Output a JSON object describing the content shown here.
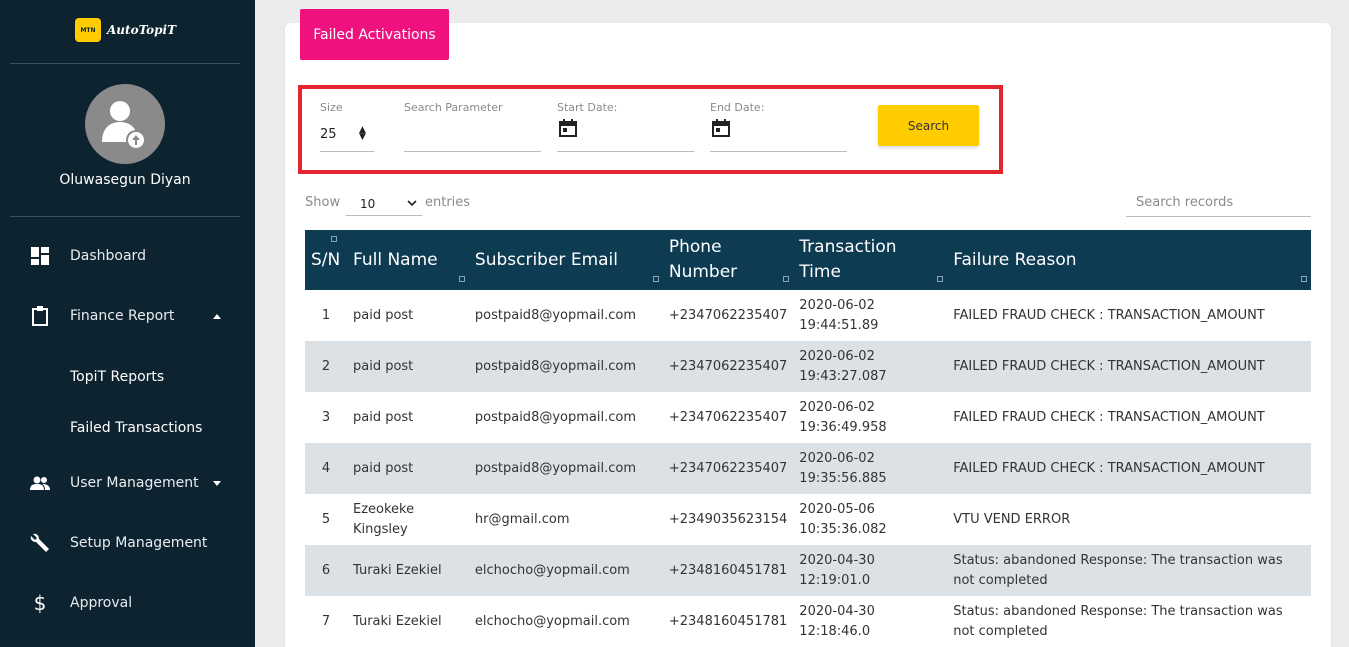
{
  "brand": {
    "logo_text": "MTN",
    "name": "AutoTopiT"
  },
  "user": {
    "name": "Oluwasegun Diyan"
  },
  "sidebar": {
    "items": [
      {
        "label": "Dashboard",
        "icon": "dashboard-icon"
      },
      {
        "label": "Finance Report",
        "icon": "clipboard-icon",
        "expanded": true,
        "children": [
          {
            "label": "TopiT Reports"
          },
          {
            "label": "Failed Transactions"
          }
        ]
      },
      {
        "label": "User Management",
        "icon": "users-icon"
      },
      {
        "label": "Setup Management",
        "icon": "wrench-icon"
      },
      {
        "label": "Approval",
        "icon": "dollar-icon"
      }
    ]
  },
  "tab": {
    "label": "Failed Activations"
  },
  "filters": {
    "size_label": "Size",
    "size_value": "25",
    "search_param_label": "Search Parameter",
    "start_date_label": "Start Date:",
    "end_date_label": "End Date:",
    "search_button": "Search"
  },
  "entries": {
    "show": "Show",
    "value": "10",
    "suffix": "entries"
  },
  "search_records": {
    "placeholder": "Search records"
  },
  "table": {
    "headers": [
      "S/N",
      "Full Name",
      "Subscriber Email",
      "Phone Number",
      "Transaction Time",
      "Failure Reason"
    ],
    "rows": [
      [
        "1",
        "paid post",
        "postpaid8@yopmail.com",
        "+2347062235407",
        "2020-06-02 19:44:51.89",
        "FAILED FRAUD CHECK : TRANSACTION_AMOUNT"
      ],
      [
        "2",
        "paid post",
        "postpaid8@yopmail.com",
        "+2347062235407",
        "2020-06-02 19:43:27.087",
        "FAILED FRAUD CHECK : TRANSACTION_AMOUNT"
      ],
      [
        "3",
        "paid post",
        "postpaid8@yopmail.com",
        "+2347062235407",
        "2020-06-02 19:36:49.958",
        "FAILED FRAUD CHECK : TRANSACTION_AMOUNT"
      ],
      [
        "4",
        "paid post",
        "postpaid8@yopmail.com",
        "+2347062235407",
        "2020-06-02 19:35:56.885",
        "FAILED FRAUD CHECK : TRANSACTION_AMOUNT"
      ],
      [
        "5",
        "Ezeokeke Kingsley",
        "hr@gmail.com",
        "+2349035623154",
        "2020-05-06 10:35:36.082",
        "VTU VEND ERROR"
      ],
      [
        "6",
        "Turaki Ezekiel",
        "elchocho@yopmail.com",
        "+2348160451781",
        "2020-04-30 12:19:01.0",
        "Status: abandoned Response: The transaction was not completed"
      ],
      [
        "7",
        "Turaki Ezekiel",
        "elchocho@yopmail.com",
        "+2348160451781",
        "2020-04-30 12:18:46.0",
        "Status: abandoned Response: The transaction was not completed"
      ]
    ]
  },
  "colors": {
    "sidebar_bg": "#0d2330",
    "tab_accent": "#ee117e",
    "search_button": "#ffcc00",
    "table_header": "#0d3b52",
    "highlight_border": "#e32530"
  }
}
